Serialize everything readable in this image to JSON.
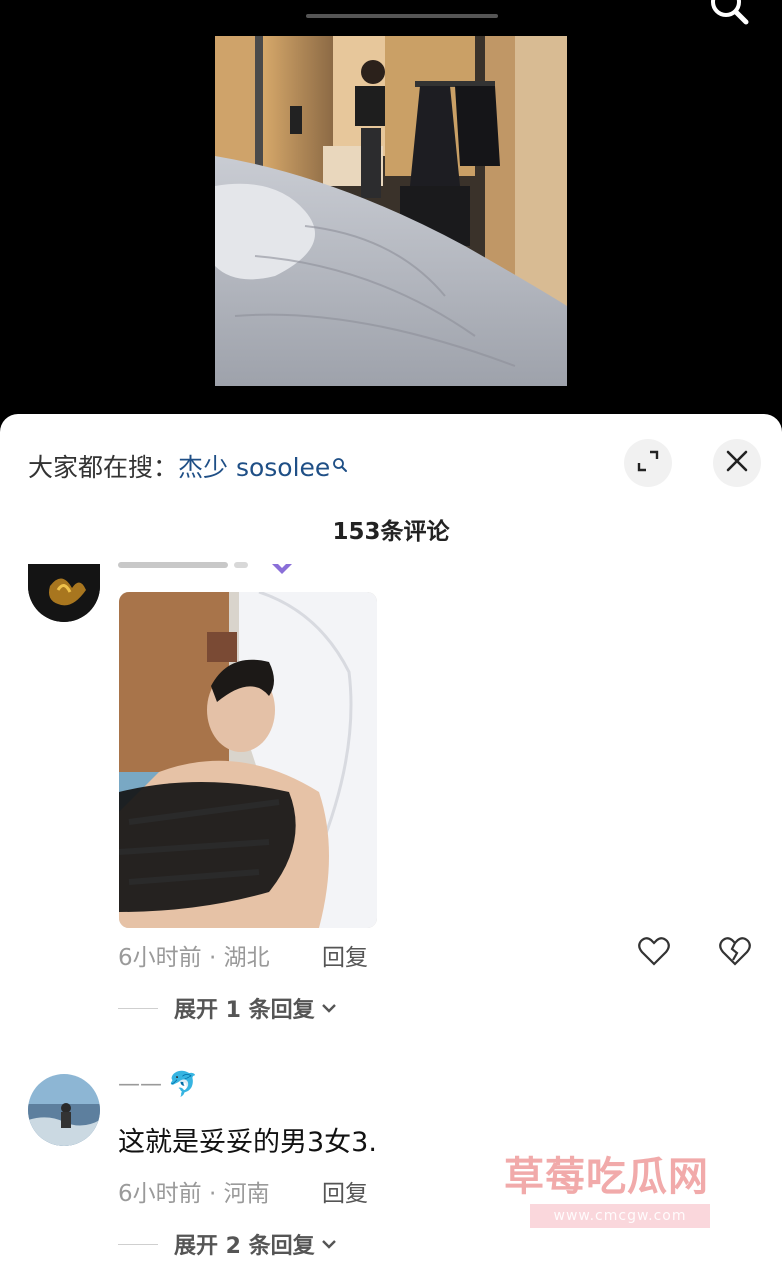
{
  "sheet": {
    "search_prefix": "大家都在搜：",
    "search_keyword": "杰少 sosolee",
    "comment_count": "153条评论"
  },
  "comments": [
    {
      "meta": "6小时前 · 湖北",
      "reply_label": "回复",
      "expand_label": "展开 1 条回复"
    },
    {
      "username": "——",
      "emoji": "🐬",
      "text": "这就是妥妥的男3女3.",
      "meta": "6小时前 · 河南",
      "reply_label": "回复",
      "expand_label": "展开 2 条回复"
    }
  ],
  "watermark": {
    "title": "草莓吃瓜网",
    "url": "www.cmcgw.com"
  },
  "icons": {
    "top": "search-icon",
    "expand": "expand-icon",
    "close": "close-icon",
    "like": "heart-icon",
    "dislike": "broken-heart-icon",
    "chevron": "chevron-down-icon"
  },
  "colors": {
    "keyword": "#1f4f86",
    "meta": "#9a9a9a",
    "watermark": "#e45656"
  }
}
